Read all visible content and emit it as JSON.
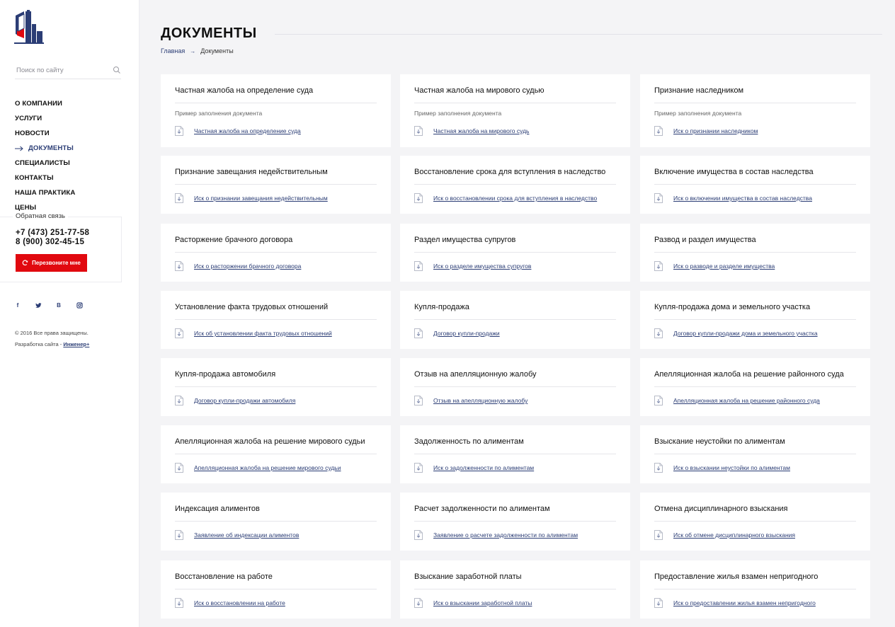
{
  "sidebar": {
    "search_placeholder": "Поиск по сайту",
    "nav": [
      "О КОМПАНИИ",
      "УСЛУГИ",
      "НОВОСТИ",
      "ДОКУМЕНТЫ",
      "СПЕЦИАЛИСТЫ",
      "КОНТАКТЫ",
      "НАША ПРАКТИКА",
      "ЦЕНЫ"
    ],
    "active_index": 3,
    "callback_label": "Обратная связь",
    "phone1": "+7 (473) 251-77-58",
    "phone2": "8 (900) 302-45-15",
    "callback_button": "Перезвоните мне",
    "social": [
      "f",
      "t",
      "B",
      "ig"
    ],
    "copyright": "© 2016 Все права защищены.",
    "dev_prefix": "Разработка сайта - ",
    "dev_link": "Инженер+"
  },
  "header": {
    "title": "ДОКУМЕНТЫ",
    "breadcrumb_home": "Главная",
    "breadcrumb_sep": "→",
    "breadcrumb_current": "Документы"
  },
  "colors": {
    "accent": "#2b3d75",
    "button": "#e1090f",
    "background": "#f4f4f6"
  },
  "cards": [
    {
      "title": "Частная жалоба на определение суда",
      "sub": "Пример заполнения документа",
      "link": "Частная жалоба на определение суда"
    },
    {
      "title": "Частная жалоба на мирового судью",
      "sub": "Пример заполнения документа",
      "link": "Частная жалоба на мирового судь"
    },
    {
      "title": "Признание наследником",
      "sub": "Пример заполнения документа",
      "link": "Иск о признании наследником"
    },
    {
      "title": "Признание завещания недействительным",
      "link": "Иск о признании завещания недействительным"
    },
    {
      "title": "Восстановление срока для вступления в наследство",
      "link": "Иск о восстановлении срока для вступления в наследство"
    },
    {
      "title": "Включение имущества в состав наследства",
      "link": "Иск о включении имущества в состав наследства"
    },
    {
      "title": "Расторжение брачного договора",
      "link": "Иск о расторжении брачного договора"
    },
    {
      "title": "Раздел имущества супругов",
      "link": "Иск о разделе имущества супругов"
    },
    {
      "title": "Развод и раздел имущества",
      "link": "Иск о разводе и разделе имущества"
    },
    {
      "title": "Установление факта трудовых отношений",
      "link": "Иск об установлении факта трудовых отношений"
    },
    {
      "title": "Купля-продажа",
      "link": "Договор купли-продажи"
    },
    {
      "title": "Купля-продажа дома и земельного участка",
      "link": "Договор купли-продажи дома и земельного участка"
    },
    {
      "title": "Купля-продажа автомобиля",
      "link": "Договор купли-продажи автомобиля"
    },
    {
      "title": "Отзыв на апелляционную жалобу",
      "link": "Отзыв на апелляционную жалобу"
    },
    {
      "title": "Апелляционная жалоба на решение районного суда",
      "link": "Апелляционная жалоба на решение районного суда"
    },
    {
      "title": "Апелляционная жалоба на решение мирового судьи",
      "link": "Апелляционная жалоба на решение мирового судьи"
    },
    {
      "title": "Задолженность по алиментам",
      "link": "Иск о задолженности по алиментам"
    },
    {
      "title": "Взыскание неустойки по алиментам",
      "link": "Иск о взыскании неустойки по алиментам"
    },
    {
      "title": "Индексация алиментов",
      "link": "Заявление об индексации алиментов"
    },
    {
      "title": "Расчет задолженности по алиментам",
      "link": "Заявление о расчете задолженности по алиментам"
    },
    {
      "title": "Отмена дисциплинарного взыскания",
      "link": "Иск об отмене дисциплинарного взыскания"
    },
    {
      "title": "Восстановление на работе",
      "link": "Иск о восстановлении на работе"
    },
    {
      "title": "Взыскание заработной платы",
      "link": "Иск о взыскании заработной платы"
    },
    {
      "title": "Предоставление жилья взамен непригодного",
      "link": "Иск о предоставлении жилья взамен непригодного"
    }
  ]
}
